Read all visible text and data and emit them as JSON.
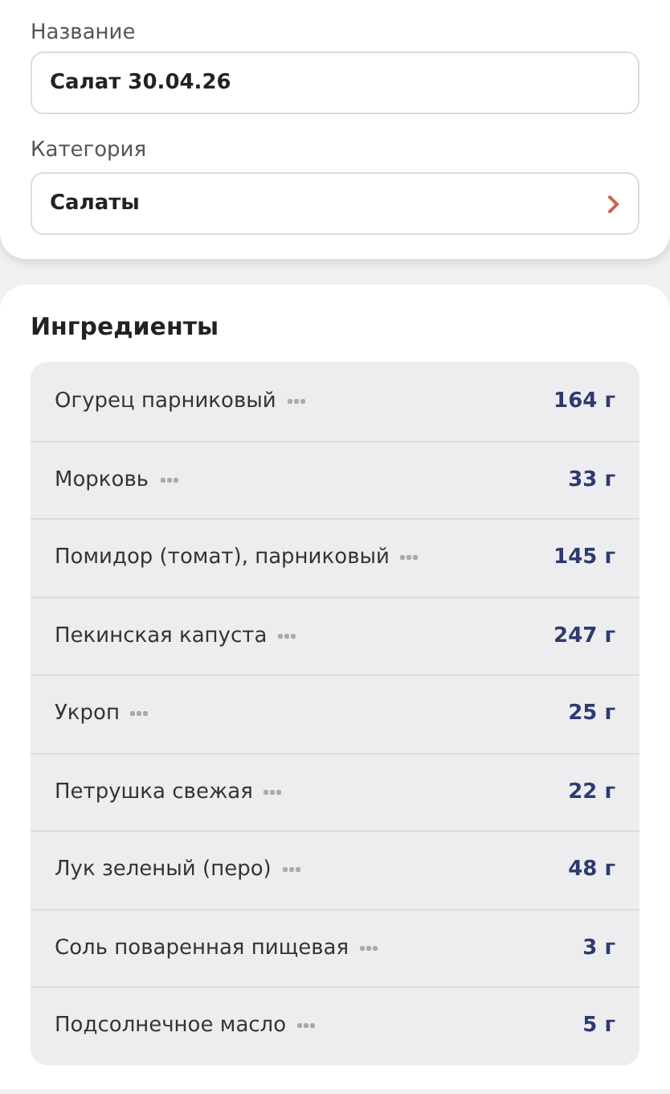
{
  "form": {
    "name_label": "Название",
    "name_value": "Салат 30.04.26",
    "category_label": "Категория",
    "category_value": "Салаты"
  },
  "ingredients": {
    "title": "Ингредиенты",
    "items": [
      {
        "name": "Огурец парниковый",
        "amount": "164 г"
      },
      {
        "name": "Морковь",
        "amount": "33 г"
      },
      {
        "name": "Помидор (томат), парниковый",
        "amount": "145 г"
      },
      {
        "name": "Пекинская капуста",
        "amount": "247 г"
      },
      {
        "name": "Укроп",
        "amount": "25 г"
      },
      {
        "name": "Петрушка свежая",
        "amount": "22 г"
      },
      {
        "name": "Лук зеленый (перо)",
        "amount": "48 г"
      },
      {
        "name": "Соль поваренная пищевая",
        "amount": "3 г"
      },
      {
        "name": "Подсолнечное масло",
        "amount": "5 г"
      }
    ]
  }
}
